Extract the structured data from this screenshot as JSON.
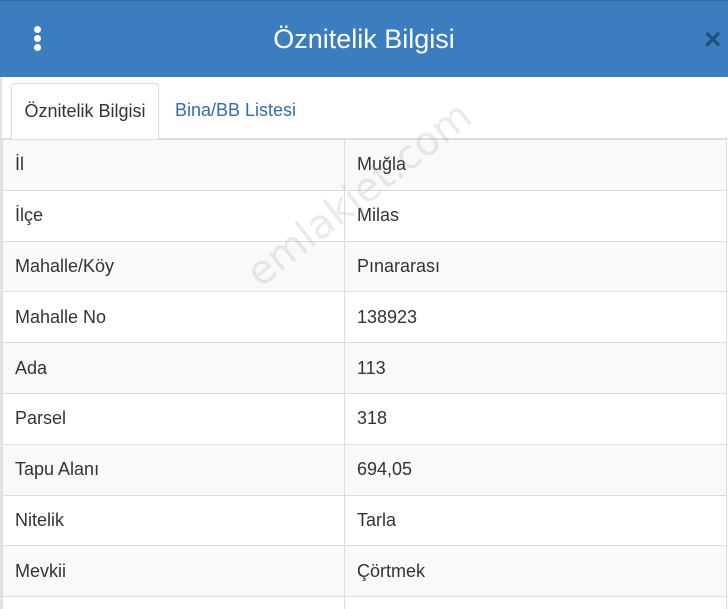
{
  "dialog": {
    "title": "Öznitelik Bilgisi",
    "close_glyph": "×",
    "menu_icon": "vertical-ellipsis-icon",
    "accent_color": "#3a7ebf"
  },
  "tabs": [
    {
      "label": "Öznitelik Bilgisi",
      "active": true
    },
    {
      "label": "Bina/BB Listesi",
      "active": false
    }
  ],
  "attributes": [
    {
      "key": "İl",
      "value": "Muğla"
    },
    {
      "key": "İlçe",
      "value": "Milas"
    },
    {
      "key": "Mahalle/Köy",
      "value": "Pınararası"
    },
    {
      "key": "Mahalle No",
      "value": "138923"
    },
    {
      "key": "Ada",
      "value": "113"
    },
    {
      "key": "Parsel",
      "value": "318"
    },
    {
      "key": "Tapu Alanı",
      "value": "694,05"
    },
    {
      "key": "Nitelik",
      "value": "Tarla"
    },
    {
      "key": "Mevkii",
      "value": "Çörtmek"
    },
    {
      "key": "",
      "value": ""
    }
  ],
  "watermark": "emlakjet.com"
}
